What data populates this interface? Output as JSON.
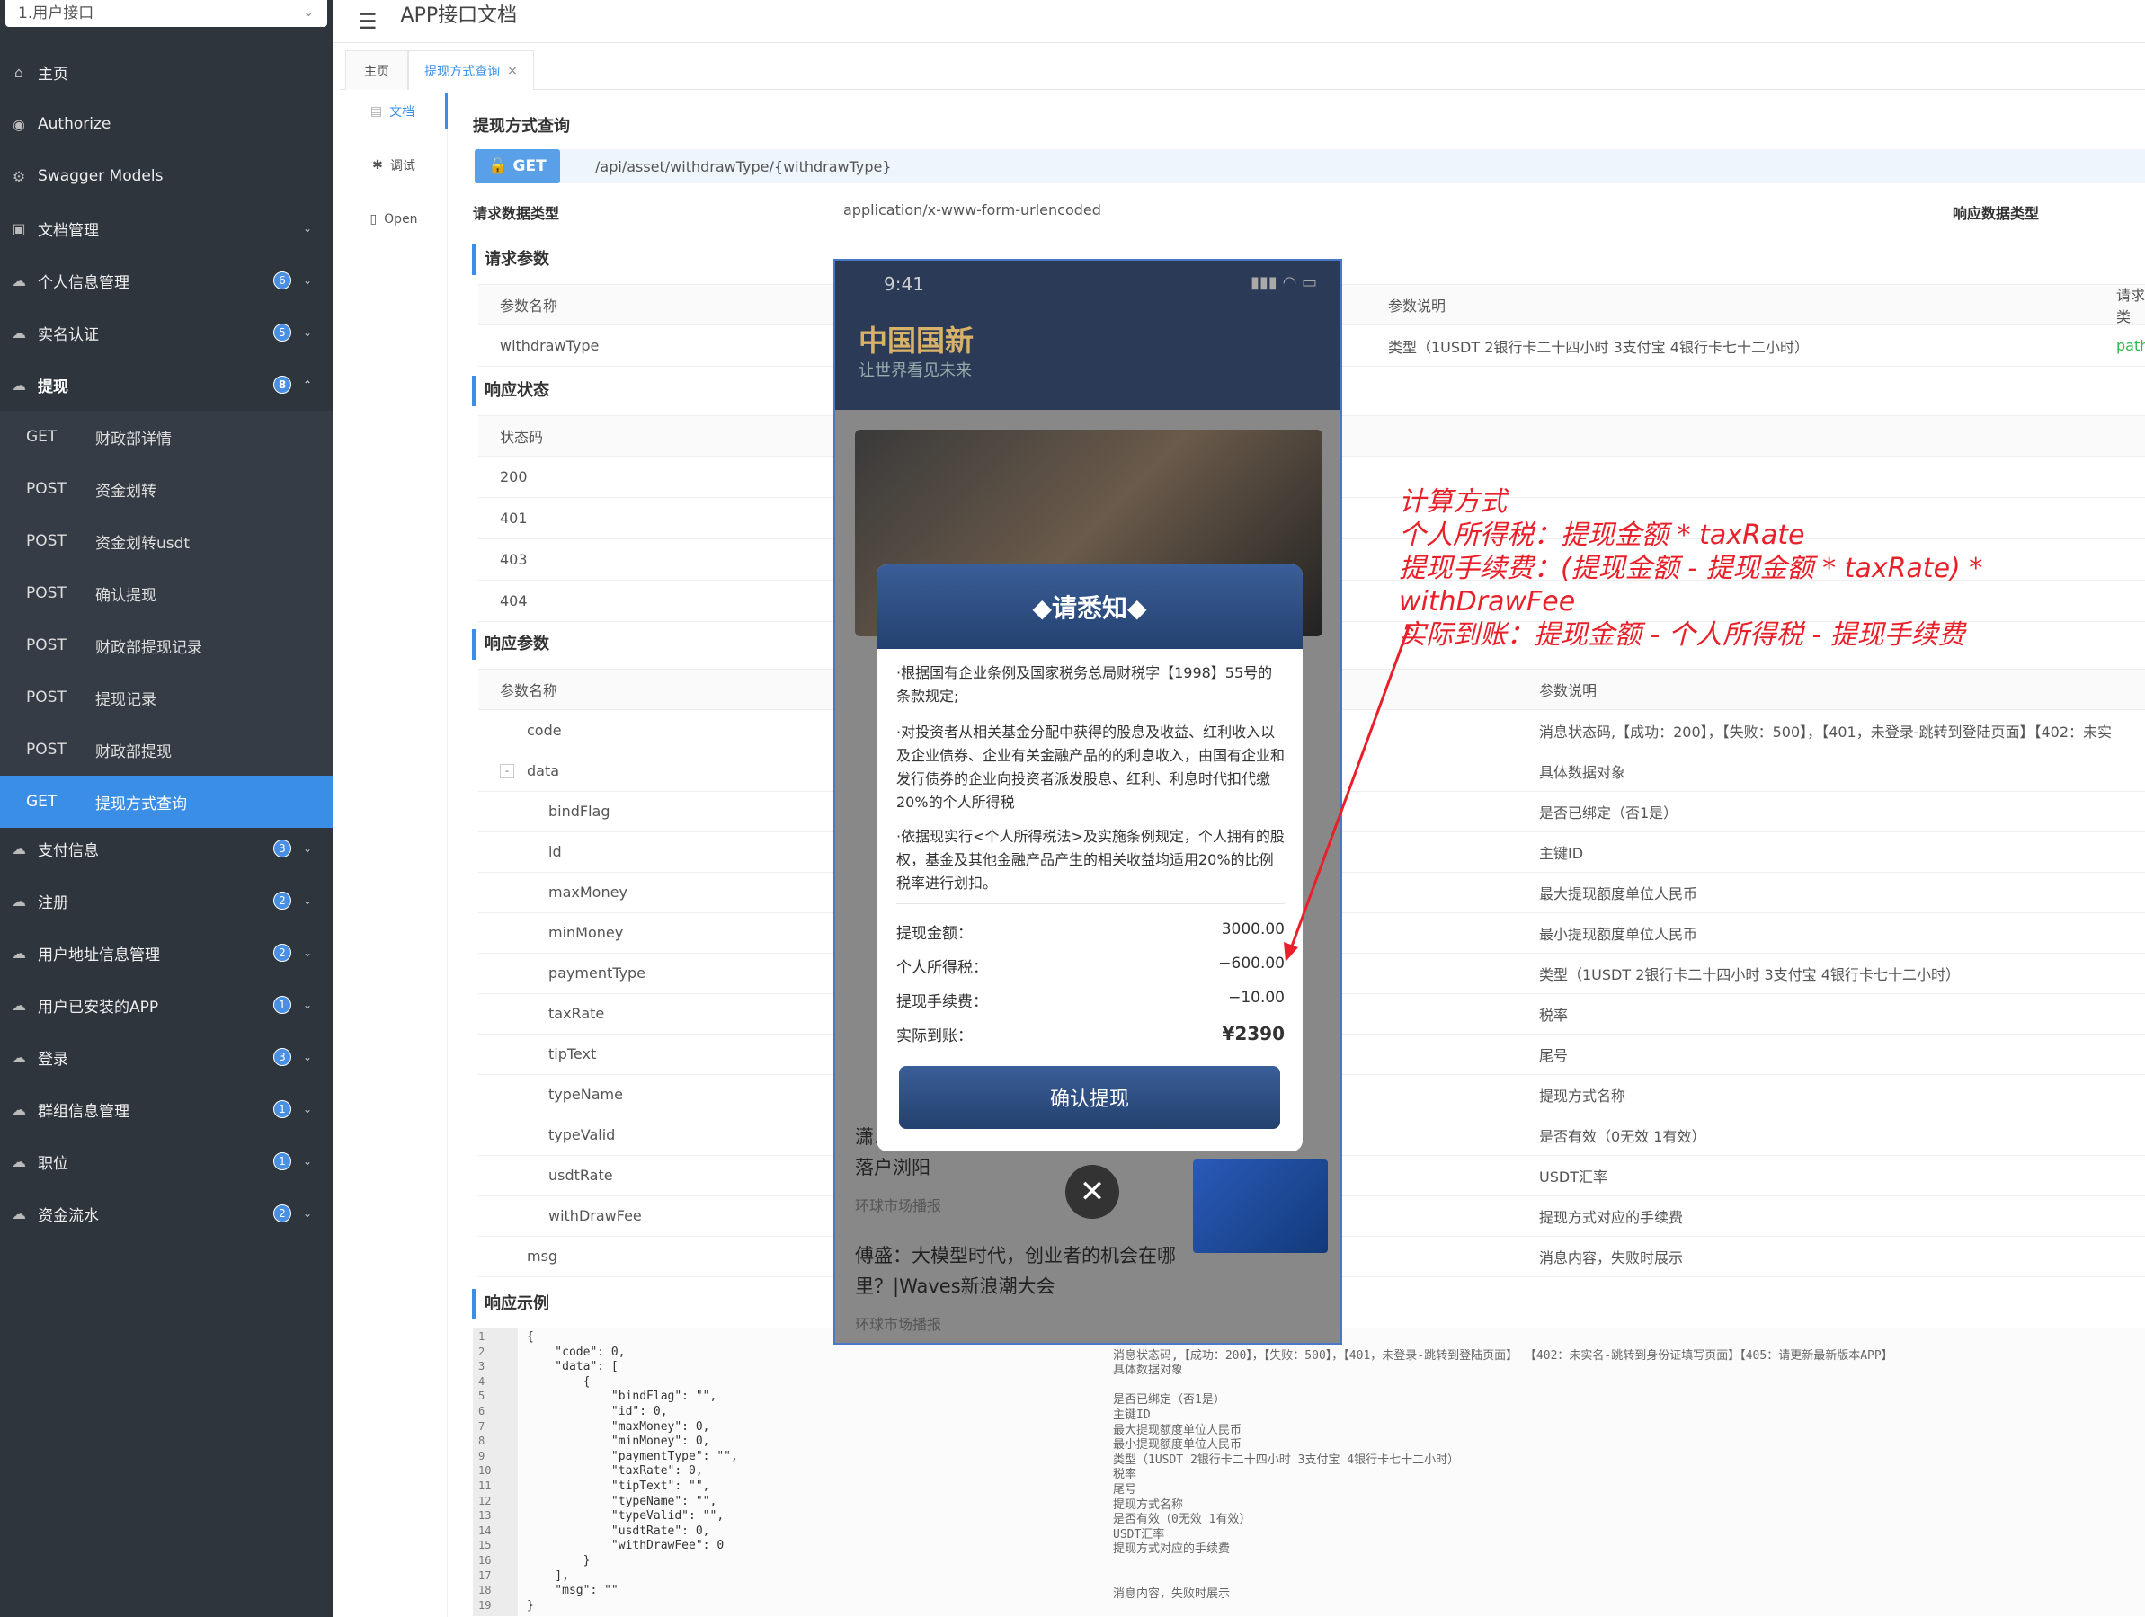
{
  "sidebar": {
    "group_select": "1.用户接口",
    "items": [
      {
        "icon": "home-icon",
        "label": "主页",
        "badge": "",
        "chev": ""
      },
      {
        "icon": "lock-icon",
        "label": "Authorize",
        "badge": "",
        "chev": ""
      },
      {
        "icon": "cube-icon",
        "label": "Swagger Models",
        "badge": "",
        "chev": ""
      },
      {
        "icon": "folder-icon",
        "label": "文档管理",
        "badge": "",
        "chev": "⌄"
      },
      {
        "icon": "cloud-icon",
        "label": "个人信息管理",
        "badge": "6",
        "chev": "⌄"
      },
      {
        "icon": "cloud-icon",
        "label": "实名认证",
        "badge": "5",
        "chev": "⌄"
      },
      {
        "icon": "cloud-icon",
        "label": "提现",
        "badge": "8",
        "chev": "⌃"
      }
    ],
    "subitems": [
      {
        "method": "GET",
        "label": "财政部详情"
      },
      {
        "method": "POST",
        "label": "资金划转"
      },
      {
        "method": "POST",
        "label": "资金划转usdt"
      },
      {
        "method": "POST",
        "label": "确认提现"
      },
      {
        "method": "POST",
        "label": "财政部提现记录"
      },
      {
        "method": "POST",
        "label": "提现记录"
      },
      {
        "method": "POST",
        "label": "财政部提现"
      },
      {
        "method": "GET",
        "label": "提现方式查询"
      }
    ],
    "items2": [
      {
        "label": "支付信息",
        "badge": "3"
      },
      {
        "label": "注册",
        "badge": "2"
      },
      {
        "label": "用户地址信息管理",
        "badge": "2"
      },
      {
        "label": "用户已安装的APP",
        "badge": "1"
      },
      {
        "label": "登录",
        "badge": "3"
      },
      {
        "label": "群组信息管理",
        "badge": "1"
      },
      {
        "label": "职位",
        "badge": "1"
      },
      {
        "label": "资金流水",
        "badge": "2"
      }
    ]
  },
  "topbar": {
    "title": "APP接口文档"
  },
  "tabs": {
    "home": "主页",
    "current": "提现方式查询",
    "close": "×"
  },
  "docnav": {
    "doc": "文档",
    "debug": "调试",
    "open": "Open"
  },
  "api": {
    "title": "提现方式查询",
    "method": "GET",
    "url": "/api/asset/withdrawType/{withdrawType}",
    "req_type_label": "请求数据类型",
    "req_type": "application/x-www-form-urlencoded",
    "resp_type_label": "响应数据类型"
  },
  "req_params": {
    "title": "请求参数",
    "h_name": "参数名称",
    "h_desc": "参数说明",
    "h_req": "请求类",
    "name": "withdrawType",
    "desc": "类型（1USDT 2银行卡二十四小时 3支付宝 4银行卡七十二小时）",
    "in": "path"
  },
  "resp_status": {
    "title": "响应状态",
    "h_code": "状态码",
    "codes": [
      "200",
      "401",
      "403",
      "404"
    ]
  },
  "resp_params": {
    "title": "响应参数",
    "h_name": "参数名称",
    "h_desc": "参数说明",
    "rows": [
      {
        "name": "code",
        "desc": "消息状态码,【成功：200】，【失败：500】，【401，未登录-跳转到登陆页面】【402：未实"
      },
      {
        "name": "data",
        "desc": "具体数据对象"
      },
      {
        "name": "bindFlag",
        "desc": "是否已绑定（否1是）"
      },
      {
        "name": "id",
        "desc": "主键ID"
      },
      {
        "name": "maxMoney",
        "desc": "最大提现额度单位人民币"
      },
      {
        "name": "minMoney",
        "desc": "最小提现额度单位人民币"
      },
      {
        "name": "paymentType",
        "desc": "类型（1USDT 2银行卡二十四小时 3支付宝 4银行卡七十二小时）"
      },
      {
        "name": "taxRate",
        "desc": "税率"
      },
      {
        "name": "tipText",
        "desc": "尾号"
      },
      {
        "name": "typeName",
        "desc": "提现方式名称"
      },
      {
        "name": "typeValid",
        "desc": "是否有效（0无效 1有效）"
      },
      {
        "name": "usdtRate",
        "desc": "USDT汇率"
      },
      {
        "name": "withDrawFee",
        "desc": "提现方式对应的手续费"
      },
      {
        "name": "msg",
        "desc": "消息内容，失败时展示"
      }
    ]
  },
  "resp_example": {
    "title": "响应示例",
    "lines": [
      {
        "n": "1",
        "code": "{",
        "c": ""
      },
      {
        "n": "2",
        "code": "    \"code\": 0,",
        "c": "消息状态码,【成功：200】，【失败：500】，【401，未登录-跳转到登陆页面】 【402：未实名-跳转到身份证填写页面】【405：请更新最新版本APP】"
      },
      {
        "n": "3",
        "code": "    \"data\": [",
        "c": "具体数据对象"
      },
      {
        "n": "4",
        "code": "        {",
        "c": ""
      },
      {
        "n": "5",
        "code": "            \"bindFlag\": \"\",",
        "c": "是否已绑定（否1是）"
      },
      {
        "n": "6",
        "code": "            \"id\": 0,",
        "c": "主键ID"
      },
      {
        "n": "7",
        "code": "            \"maxMoney\": 0,",
        "c": "最大提现额度单位人民币"
      },
      {
        "n": "8",
        "code": "            \"minMoney\": 0,",
        "c": "最小提现额度单位人民币"
      },
      {
        "n": "9",
        "code": "            \"paymentType\": \"\",",
        "c": "类型（1USDT 2银行卡二十四小时 3支付宝 4银行卡七十二小时）"
      },
      {
        "n": "10",
        "code": "            \"taxRate\": 0,",
        "c": "税率"
      },
      {
        "n": "11",
        "code": "            \"tipText\": \"\",",
        "c": "尾号"
      },
      {
        "n": "12",
        "code": "            \"typeName\": \"\",",
        "c": "提现方式名称"
      },
      {
        "n": "13",
        "code": "            \"typeValid\": \"\",",
        "c": "是否有效（0无效 1有效）"
      },
      {
        "n": "14",
        "code": "            \"usdtRate\": 0,",
        "c": "USDT汇率"
      },
      {
        "n": "15",
        "code": "            \"withDrawFee\": 0",
        "c": "提现方式对应的手续费"
      },
      {
        "n": "16",
        "code": "        }",
        "c": ""
      },
      {
        "n": "17",
        "code": "    ],",
        "c": ""
      },
      {
        "n": "18",
        "code": "    \"msg\": \"\"",
        "c": "消息内容，失败时展示"
      },
      {
        "n": "19",
        "code": "}",
        "c": ""
      }
    ]
  },
  "phone": {
    "time": "9:41",
    "signal": "▮▮▮ ◠ ▭",
    "brand": "中国国新",
    "slogan": "让世界看见未来",
    "news1": "潇...                   ...地\n落户浏阳",
    "src1": "环球市场播报",
    "news2": "傅盛：大模型时代，创业者的机会在哪\n里？|Waves新浪潮大会",
    "src2": "环球市场播报"
  },
  "dialog": {
    "title": "◆请悉知◆",
    "p1": "·根据国有企业条例及国家税务总局财税字【1998】55号的条款规定;",
    "p2": "·对投资者从相关基金分配中获得的股息及收益、红利收入以及企业债券、企业有关金融产品的的利息收入，由国有企业和发行债券的企业向投资者派发股息、红利、利息时代扣代缴20%的个人所得税",
    "p3": "·依据现实行<个人所得税法>及实施条例规定，个人拥有的股权，基金及其他金融产品产生的相关收益均适用20%的比例税率进行划扣。",
    "amount_label": "提现金额：",
    "amount": "3000.00",
    "tax_label": "个人所得税：",
    "tax": "−600.00",
    "fee_label": "提现手续费：",
    "fee": "−10.00",
    "net_label": "实际到账：",
    "net": "¥2390",
    "confirm": "确认提现",
    "close": "✕"
  },
  "annotation": {
    "l1": "计算方式",
    "l2": "个人所得税：提现金额 * taxRate",
    "l3": "提现手续费：(提现金额 - 提现金额 * taxRate) * withDrawFee",
    "l4": "实际到账：提现金额 - 个人所得税 - 提现手续费",
    "color": "#e8202a"
  }
}
